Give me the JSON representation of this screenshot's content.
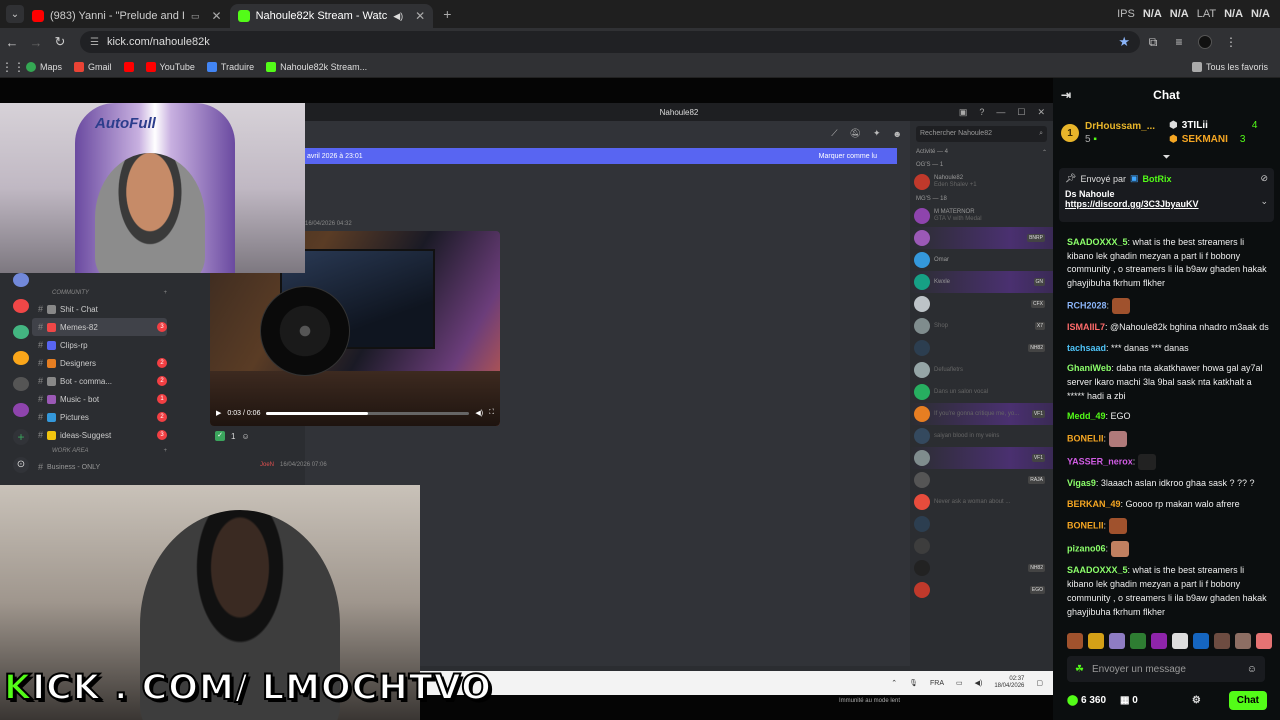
{
  "browser": {
    "tabs": [
      {
        "title": "(983) Yanni - \"Prelude and I",
        "icon_color": "#ff0000"
      },
      {
        "title": "Nahoule82k Stream - Watc",
        "icon_color": "#53fc18"
      }
    ],
    "new_tab": "+",
    "ticker": [
      {
        "label": "IPS",
        "value": "N/A"
      },
      {
        "label": "",
        "value": "N/A"
      },
      {
        "label": "LAT",
        "value": "N/A"
      },
      {
        "label": "",
        "value": "N/A"
      }
    ],
    "url": "kick.com/nahoule82k",
    "bookmarks": [
      {
        "label": "Maps",
        "color": "#34a853"
      },
      {
        "label": "Gmail",
        "color": "#ea4335"
      },
      {
        "label": "",
        "color": "#ff0000"
      },
      {
        "label": "YouTube",
        "color": "#ff0000"
      },
      {
        "label": "Traduire",
        "color": "#4285f4"
      },
      {
        "label": "Nahoule82k Stream...",
        "color": "#53fc18"
      }
    ],
    "all_bookmarks": "Tous les favoris"
  },
  "discord": {
    "window_title": "Nahoule82",
    "search_placeholder": "Rechercher Nahoule82",
    "unread_banner": "avril 2026 à 23:01",
    "mark_read": "Marquer comme lu",
    "msg1_time": "16/04/2026 04:32",
    "video_time": "0:03 / 0:06",
    "reaction_count": "1",
    "msg2_user": "JoeN",
    "msg2_time": "16/04/2026 07:06",
    "immunity": "Immunité au mode lent",
    "activity_header": "Activité — 4",
    "og_header": "OG'S — 1",
    "mg_header": "MG'S — 18",
    "category": "COMMUNITY",
    "channels": [
      {
        "name": "Shit - Chat",
        "badge": "",
        "color": "#888"
      },
      {
        "name": "Memes-82",
        "badge": "3",
        "color": "#f04747"
      },
      {
        "name": "Clips-rp",
        "badge": "",
        "color": "#5865f2"
      },
      {
        "name": "Designers",
        "badge": "2",
        "color": "#e67e22"
      },
      {
        "name": "Bot - comma...",
        "badge": "2",
        "color": "#888"
      },
      {
        "name": "Music - bot",
        "badge": "1",
        "color": "#9b59b6"
      },
      {
        "name": "Pictures",
        "badge": "2",
        "color": "#3498db"
      },
      {
        "name": "ideas-Suggest",
        "badge": "3",
        "color": "#f1c40f"
      }
    ],
    "work_area": "WORK AREA",
    "business": "Business - ONLY",
    "members": [
      {
        "name": "Nahoule82",
        "sub": "Eden Shalev +1",
        "color": "#c0392b",
        "tag": ""
      },
      {
        "name": "M MATERNOR",
        "sub": "GTA V with Medal",
        "color": "#8e44ad",
        "tag": ""
      },
      {
        "name": "",
        "sub": "",
        "color": "#9b59b6",
        "tag": "BNRP"
      },
      {
        "name": "Omar",
        "sub": "",
        "color": "#3498db",
        "tag": ""
      },
      {
        "name": "Kwxle",
        "sub": "",
        "color": "#16a085",
        "tag": "GN"
      },
      {
        "name": "",
        "sub": "",
        "color": "#bdc3c7",
        "tag": "CFX"
      },
      {
        "name": "",
        "sub": "Shop",
        "color": "#7f8c8d",
        "tag": "X7"
      },
      {
        "name": "",
        "sub": "",
        "color": "#2c3e50",
        "tag": "NH82"
      },
      {
        "name": "",
        "sub": "Defuafletrs",
        "color": "#95a5a6",
        "tag": ""
      },
      {
        "name": "",
        "sub": "Dans un salon vocal",
        "color": "#27ae60",
        "tag": ""
      },
      {
        "name": "",
        "sub": "If you're gonna critique me, yo...",
        "color": "#e67e22",
        "tag": "VF1"
      },
      {
        "name": "",
        "sub": "saiyan blood in my veins",
        "color": "#34495e",
        "tag": ""
      },
      {
        "name": "",
        "sub": "",
        "color": "#7f8c8d",
        "tag": "VF1"
      },
      {
        "name": "",
        "sub": "",
        "color": "#555",
        "tag": "RAJA"
      },
      {
        "name": "",
        "sub": "Never ask a woman about ...",
        "color": "#e74c3c",
        "tag": ""
      },
      {
        "name": "",
        "sub": "",
        "color": "#2c3e50",
        "tag": ""
      },
      {
        "name": "",
        "sub": "",
        "color": "#3d3d3d",
        "tag": ""
      },
      {
        "name": "",
        "sub": "",
        "color": "#222",
        "tag": "NH82"
      },
      {
        "name": "",
        "sub": "",
        "color": "#c0392b",
        "tag": "EGO"
      }
    ],
    "taskbar_lang": "FRA",
    "taskbar_time": "02:37",
    "taskbar_date": "18/04/2026"
  },
  "stream": {
    "webcam_logo": "AutoFull",
    "watermark_k": "K",
    "watermark_rest": "ICK . COM/ LMOCHTVO",
    "video_progress": 0.5
  },
  "chat": {
    "title": "Chat",
    "leaderboard": {
      "first": {
        "rank": "1",
        "user": "DrHoussam_...",
        "count": "5"
      },
      "second": {
        "user": "3TILii",
        "count": "4"
      },
      "third": {
        "user": "SEKMANI",
        "count": "3"
      }
    },
    "pinned": {
      "sent_by": "Envoyé par",
      "bot": "BotRix",
      "title": "Ds Nahoule",
      "link": "https://discord.gg/3C3JbyauKV"
    },
    "messages": [
      {
        "user": "SAADOXXX_5",
        "color": "#8cff6b",
        "text": "what is the best streamers li kibano lek ghadin mezyan a part li f bobony community , o streamers li ila b9aw ghaden hakak ghayjibuha fkrhum flkher",
        "emote": ""
      },
      {
        "user": "RCH2028",
        "color": "#8ab4f8",
        "text": "",
        "emote": "#a0522d"
      },
      {
        "user": "ISMAIIL7",
        "color": "#ff6b6b",
        "text": "@Nahoule82k bghina nhadro m3aak ds",
        "emote": ""
      },
      {
        "user": "tachsaad",
        "color": "#4fc3f7",
        "text": "*** danas *** danas",
        "emote": ""
      },
      {
        "user": "GhaniWeb",
        "color": "#8cff6b",
        "text": "daba nta akatkhawer howa gal ay7al server lkaro machi 3la 9bal sask nta katkhalt a ***** hadi a zbi",
        "emote": ""
      },
      {
        "user": "Medd_49",
        "color": "#53fc18",
        "text": "EGO",
        "emote": ""
      },
      {
        "user": "BONELII",
        "color": "#f5a623",
        "text": "",
        "emote": "#b07a7a"
      },
      {
        "user": "YASSER_nerox",
        "color": "#d05ce3",
        "text": "",
        "emote": "#222"
      },
      {
        "user": "Vigas9",
        "color": "#8cff6b",
        "text": "3laaach aslan idkroo ghaa sask ? ?? ?",
        "emote": ""
      },
      {
        "user": "BERKAN_49",
        "color": "#f5a623",
        "text": "Goooo rp makan walo afrere",
        "emote": ""
      },
      {
        "user": "BONELII",
        "color": "#f5a623",
        "text": "",
        "emote": "#a0522d"
      },
      {
        "user": "pizano06",
        "color": "#8cff6b",
        "text": "",
        "emote": "#c08060"
      },
      {
        "user": "SAADOXXX_5",
        "color": "#8cff6b",
        "text": "what is the best streamers li kibano lek ghadin mezyan a part li f bobony community , o streamers li ila b9aw ghaden hakak ghayjibuha fkrhum flkher",
        "emote": ""
      }
    ],
    "emote_bar": [
      "#a0522d",
      "#d4a017",
      "#8e7cc3",
      "#2e7d32",
      "#8e24aa",
      "#ddd",
      "#1565c0",
      "#6d4c41",
      "#8d6e63",
      "#e57373"
    ],
    "input_placeholder": "Envoyer un message",
    "points": "6 360",
    "gifts": "0",
    "send_button": "Chat"
  }
}
